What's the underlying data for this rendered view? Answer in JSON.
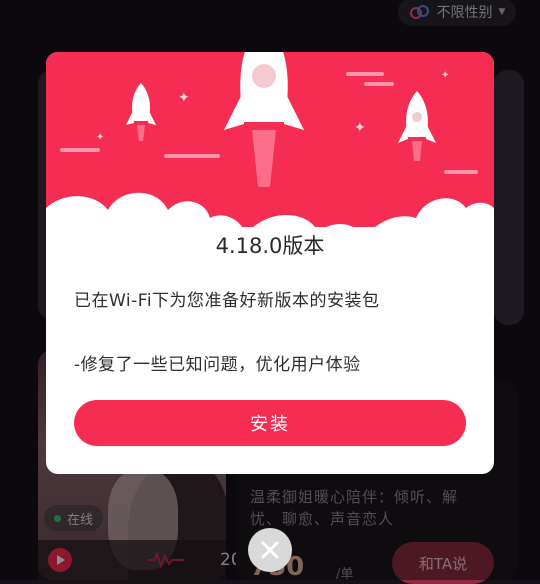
{
  "background": {
    "filter": {
      "label": "不限性别",
      "icon": "gender-symbol-icon"
    },
    "card": {
      "online_status": "在线",
      "duration": "20\"",
      "description": "温柔御姐暖心陪伴：倾听、解忧、聊愈、声音恋人",
      "price": "750",
      "price_unit": "/单",
      "chat_button": "和TA说"
    }
  },
  "dialog": {
    "version_title": "4.18.0版本",
    "notes": [
      "已在Wi-Fi下为您准备好新版本的安装包",
      "-修复了一些已知问题，优化用户体验"
    ],
    "install_button": "安装",
    "close_icon": "close-icon"
  },
  "colors": {
    "accent": "#f52d52",
    "dialog_bg": "#ffffff",
    "page_bg": "#141118"
  }
}
